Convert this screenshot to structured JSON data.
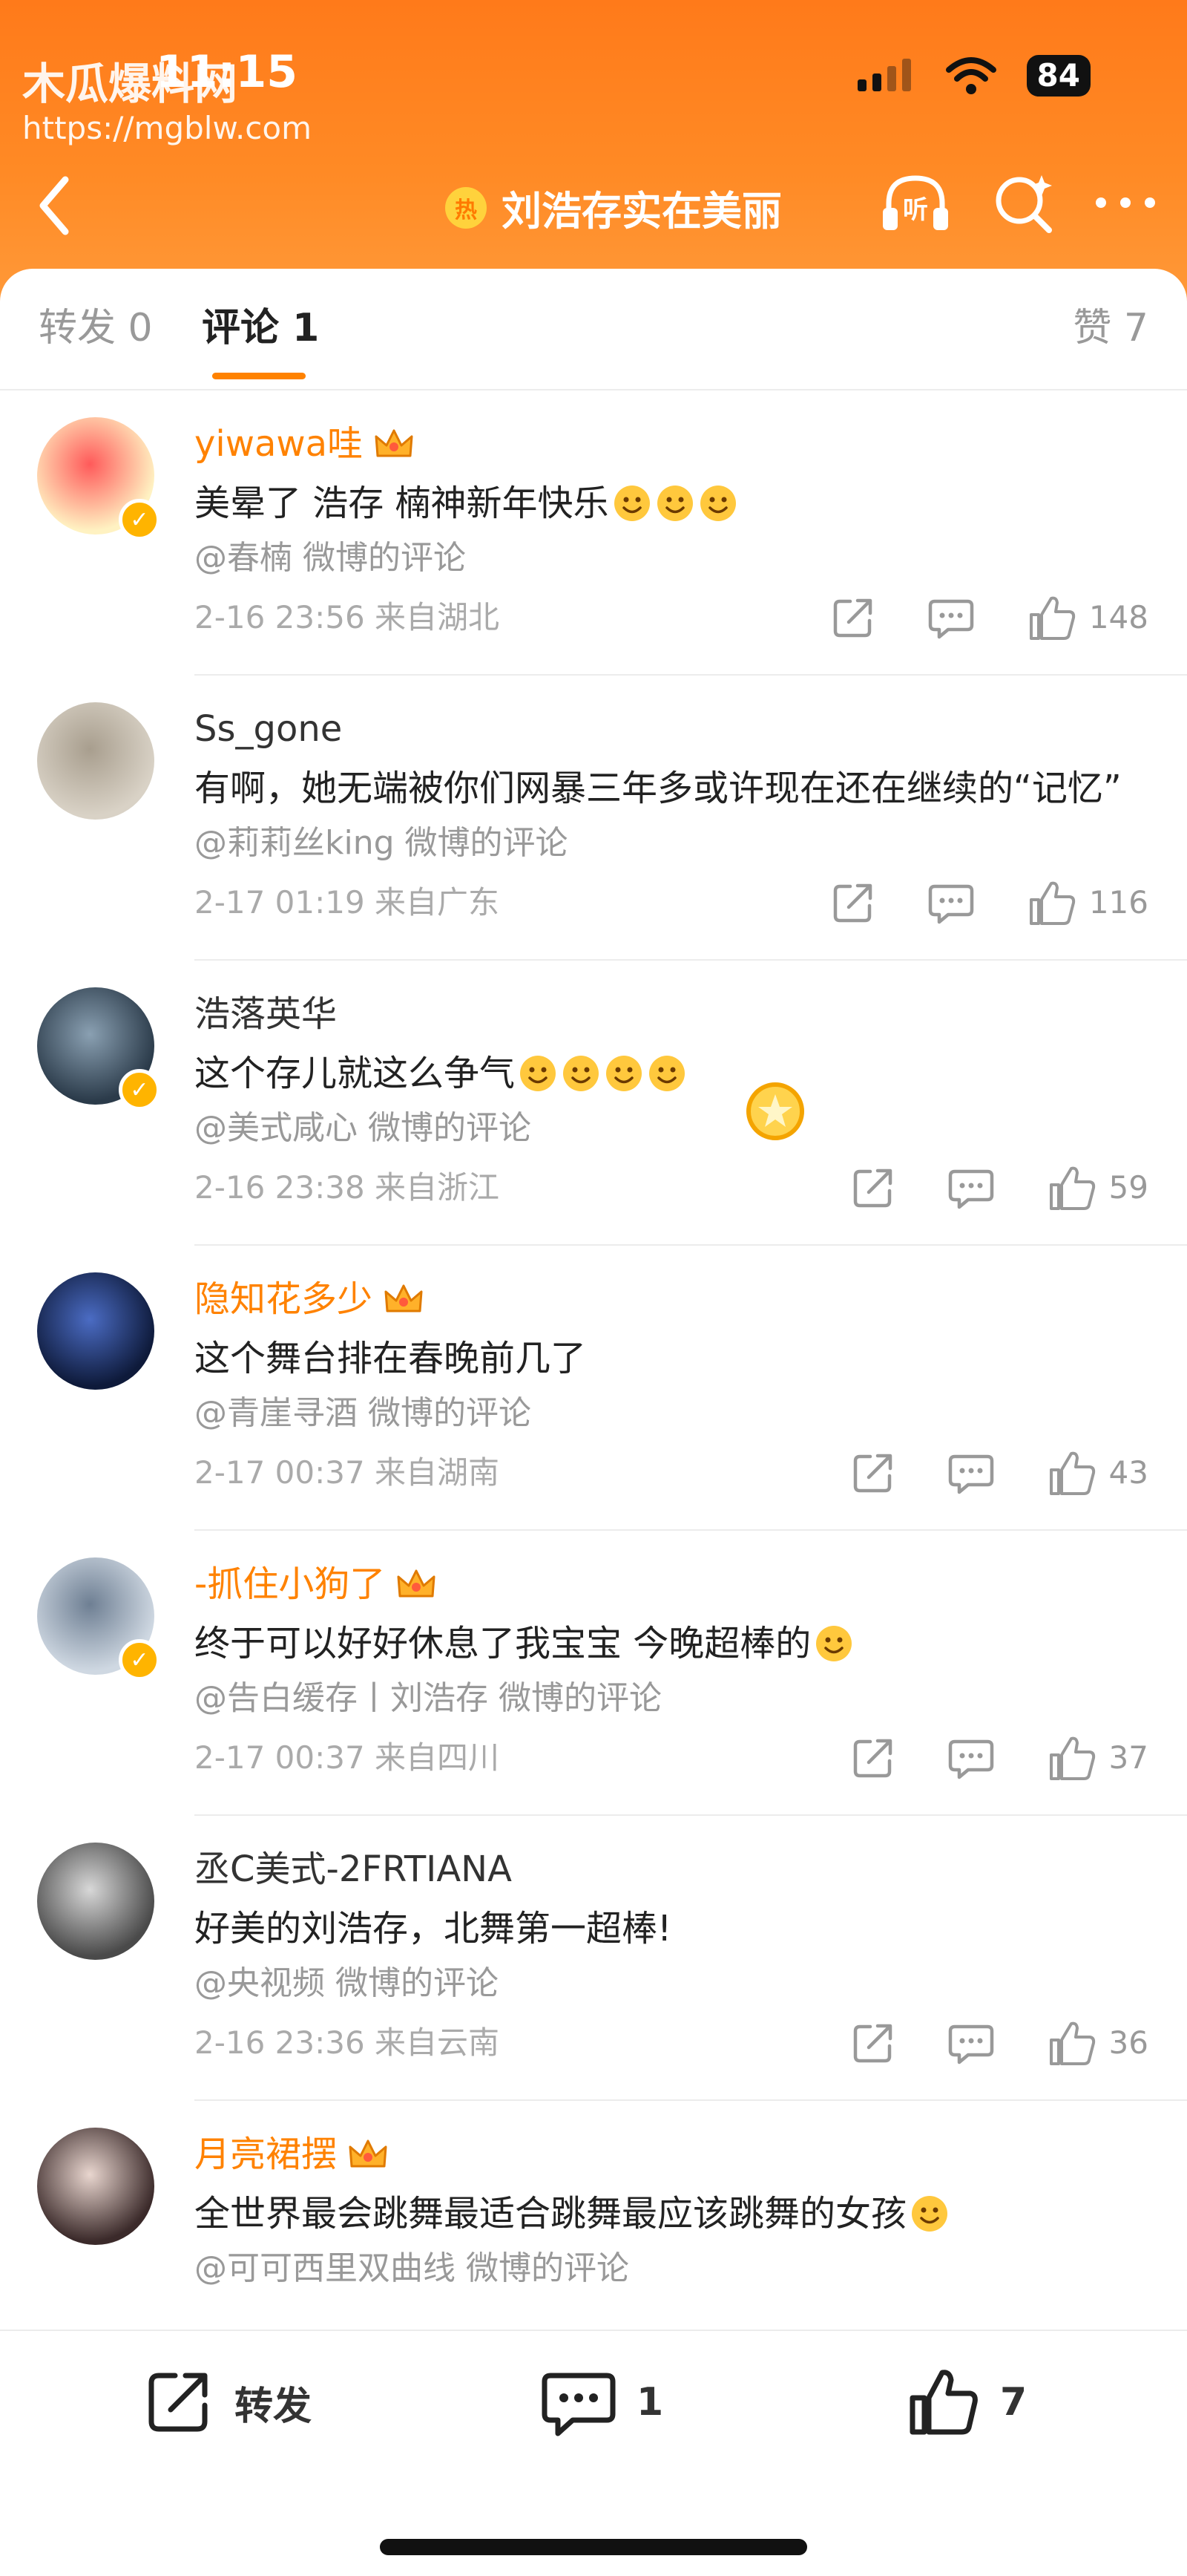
{
  "status_bar": {
    "time": "11:15",
    "battery": "84",
    "watermark_title": "木瓜爆料网",
    "watermark_url": "https://mgblw.com"
  },
  "nav": {
    "hot_badge": "热",
    "title": "刘浩存实在美丽",
    "listen_label": "听"
  },
  "tabs": {
    "repost": "转发 0",
    "comment": "评论 1",
    "like": "赞 7"
  },
  "comments": [
    {
      "name": "yiwawa哇",
      "name_color": "#ff8200",
      "text": "美晕了 浩存 楠神新年快乐",
      "source": "@春楠 微博的评论",
      "meta": "2-16 23:56  来自湖北",
      "likes": "148",
      "verified": true,
      "crown": true
    },
    {
      "name": "Ss_gone",
      "name_color": "#333333",
      "text": "有啊，她无端被你们网暴三年多或许现在还在继续的“记忆”",
      "source": "@莉莉丝king 微博的评论",
      "meta": "2-17 01:19  来自广东",
      "likes": "116",
      "verified": false,
      "crown": false
    },
    {
      "name": "浩落英华",
      "name_color": "#333333",
      "text": "这个存儿就这么争气",
      "source": "@美式咸心 微博的评论",
      "meta": "2-16 23:38  来自浙江",
      "likes": "59",
      "verified": true,
      "crown": false
    },
    {
      "name": "隐知花多少",
      "name_color": "#ff8200",
      "text": "这个舞台排在春晚前几了",
      "source": "@青崖寻酒 微博的评论",
      "meta": "2-17 00:37  来自湖南",
      "likes": "43",
      "verified": false,
      "crown": true
    },
    {
      "name": "-抓住小狗了",
      "name_color": "#ff8200",
      "text": "终于可以好好休息了我宝宝 今晚超棒的",
      "source": "@告白缓存丨刘浩存 微博的评论",
      "meta": "2-17 00:37  来自四川",
      "likes": "37",
      "verified": true,
      "crown": true
    },
    {
      "name": "丞C美式-2FRTIANA",
      "name_color": "#333333",
      "text": "好美的刘浩存，北舞第一超棒!",
      "source": "@央视频 微博的评论",
      "meta": "2-16 23:36  来自云南",
      "likes": "36",
      "verified": false,
      "crown": false
    },
    {
      "name": "月亮裙摆",
      "name_color": "#ff8200",
      "text": "全世界最会跳舞最适合跳舞最应该跳舞的女孩",
      "source": "@可可西里双曲线 微博的评论",
      "meta": "",
      "likes": "",
      "verified": false,
      "crown": true
    }
  ],
  "bottom_bar": {
    "repost": "转发",
    "comment_count": "1",
    "like_count": "7"
  },
  "colors": {
    "accent": "#ff8200",
    "header_gradient_top": "#ff7a1a",
    "header_gradient_bottom": "#ff9a3a"
  }
}
